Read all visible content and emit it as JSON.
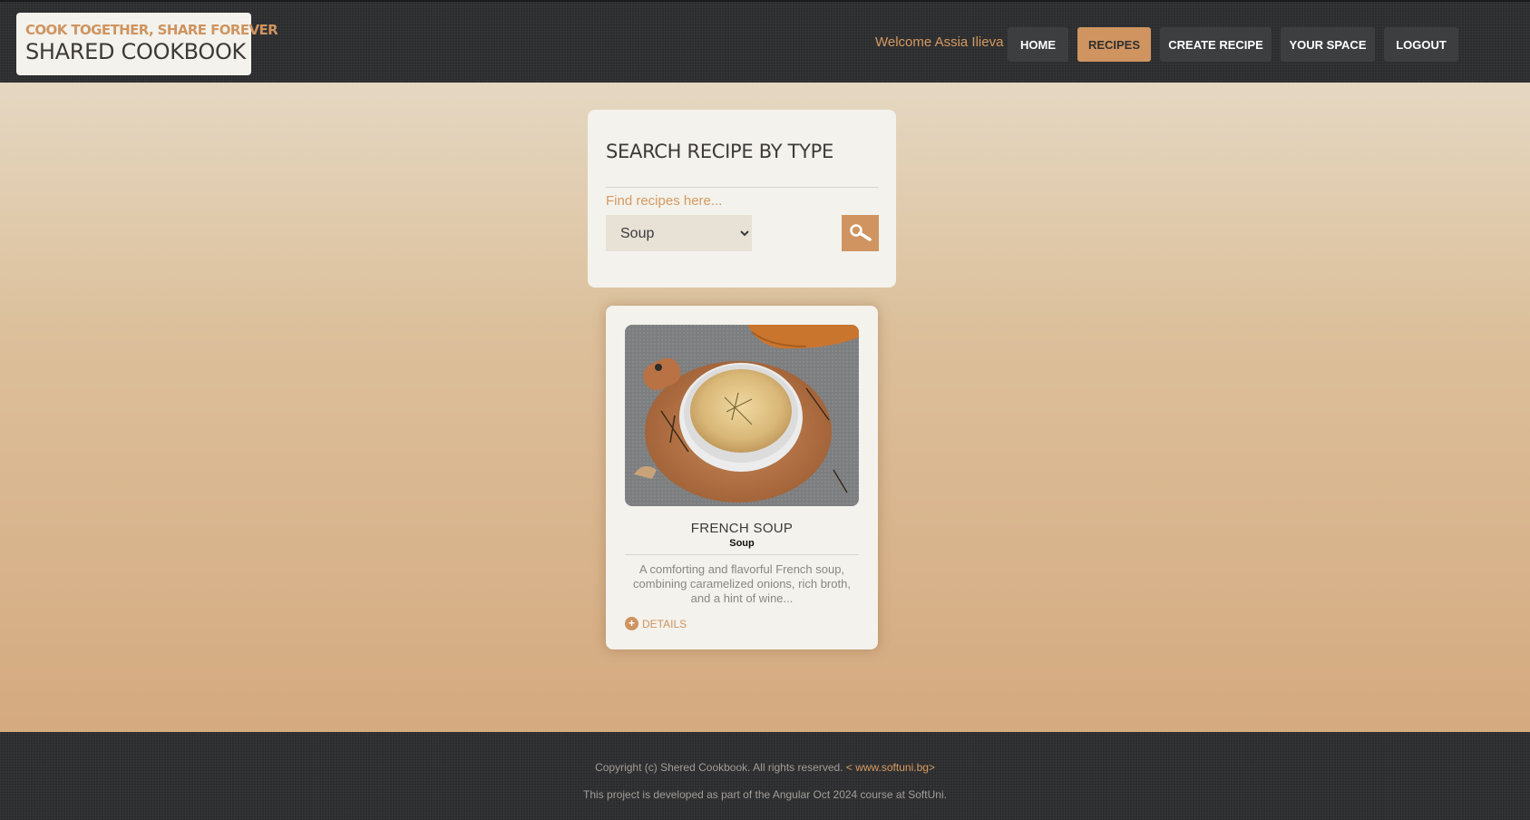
{
  "header": {
    "logo_tagline": "COOK TOGETHER, SHARE FOREVER",
    "logo_title": "SHARED COOKBOOK",
    "welcome_text": "Welcome Assia Ilieva",
    "nav": {
      "home": "HOME",
      "recipes": "RECIPES",
      "create_recipe": "CREATE RECIPE",
      "your_space": "YOUR SPACE",
      "logout": "LOGOUT"
    },
    "active_nav": "RECIPES"
  },
  "search": {
    "title": "SEARCH RECIPE BY TYPE",
    "hint": "Find recipes here...",
    "selected_type": "Soup",
    "button_icon": "search-icon"
  },
  "recipe": {
    "name": "FRENCH SOUP",
    "type": "Soup",
    "description": "A comforting and flavorful French soup, combining caramelized onions, rich broth, and a hint of wine...",
    "details_label": "DETAILS"
  },
  "footer": {
    "copyright": "Copyright (c) Shered Cookbook. All rights reserved.",
    "link_text": "< www.softuni.bg>",
    "project_note": "This project is developed as part of the Angular Oct 2024 course at SoftUni."
  },
  "colors": {
    "accent": "#cf9460",
    "dark": "#2f3032",
    "panel": "#f3f2ec"
  }
}
